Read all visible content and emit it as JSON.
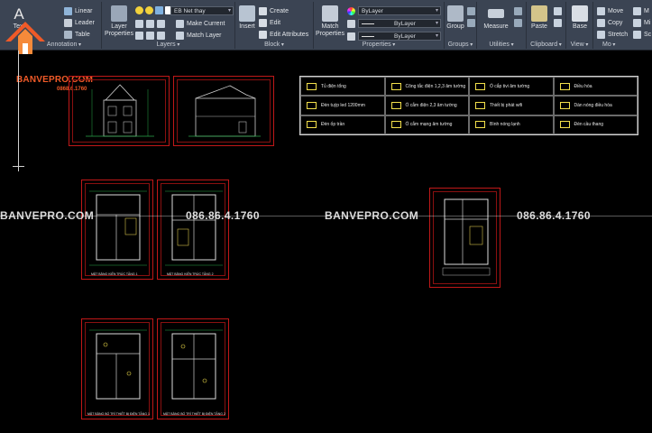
{
  "ribbon": {
    "annotation": {
      "text_label": "Text",
      "linear_label": "Linear",
      "leader_label": "Leader",
      "table_label": "Table",
      "panel_label": "Annotation"
    },
    "layers": {
      "layer_properties_label": "Layer Properties",
      "layer_value": "EB Net thay",
      "make_current_label": "Make Current",
      "match_layer_label": "Match Layer",
      "panel_label": "Layers"
    },
    "block": {
      "insert_label": "Insert",
      "create_label": "Create",
      "edit_label": "Edit",
      "edit_attributes_label": "Edit Attributes",
      "panel_label": "Block"
    },
    "properties": {
      "match_properties_label": "Match Properties",
      "color_value": "ByLayer",
      "linetype_value": "ByLayer",
      "lineweight_value": "ByLayer",
      "panel_label": "Properties"
    },
    "groups": {
      "group_label": "Group",
      "panel_label": "Groups"
    },
    "utilities": {
      "measure_label": "Measure",
      "panel_label": "Utilities"
    },
    "clipboard": {
      "paste_label": "Paste",
      "panel_label": "Clipboard"
    },
    "view": {
      "base_label": "Base",
      "panel_label": "View"
    },
    "modify": {
      "move_label": "Move",
      "copy_label": "Copy",
      "stretch_label": "Stretch",
      "m_label": "M",
      "mi_label": "Mi",
      "sc_label": "Sc",
      "panel_label": "Mo"
    }
  },
  "logo": {
    "brand": "BANVEPRO.COM",
    "phone": "0868.6.1760"
  },
  "watermark": {
    "left": "BANVEPRO.COM",
    "phone1": "086.86.4.1760",
    "center": "BANVEPRO.COM",
    "phone2": "086.86.4.1760"
  },
  "legend": [
    "Tủ điện tổng",
    "Công tắc điện 1,2,3 âm tường",
    "Ổ cắp tivi âm tường",
    "Điều hòa",
    "Đèn tuýp led 1200mm",
    "Ổ cắm điện 2,3 âm tường",
    "Thiết bị phát wifi",
    "Dàn nóng điều hòa",
    "Đèn ốp trần",
    "Ổ cắm mạng âm tường",
    "Bình nóng lạnh",
    "Đèn cầu thang"
  ],
  "sheet_captions": {
    "plan1": "MẶT BẰNG KIẾN TRÚC TẦNG 1",
    "plan2": "MẶT BẰNG KIẾN TRÚC TẦNG 2",
    "plan3": "MẶT BẰNG BỐ TRÍ THIẾT BỊ ĐIỆN TẦNG 1",
    "plan4": "MẶT BẰNG BỐ TRÍ THIẾT BỊ ĐIỆN TẦNG 2"
  },
  "colors": {
    "ribbon_bg": "#3b4453",
    "canvas_bg": "#000000",
    "sheet_border": "#c01818",
    "brand_orange": "#f05a28",
    "legend_symbol": "#f3e04a"
  }
}
